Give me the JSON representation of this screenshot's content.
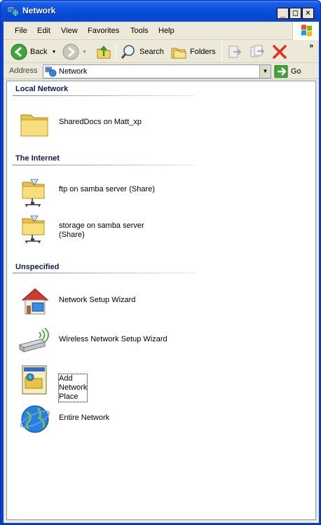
{
  "window": {
    "title": "Network",
    "controls": {
      "minimize": "_",
      "maximize": "□",
      "close": "×"
    }
  },
  "menu": [
    "File",
    "Edit",
    "View",
    "Favorites",
    "Tools",
    "Help"
  ],
  "toolbar": {
    "back_label": "Back",
    "search_label": "Search",
    "folders_label": "Folders",
    "more": "»"
  },
  "address": {
    "label": "Address",
    "value": "Network",
    "go_label": "Go"
  },
  "groups": {
    "local": {
      "title": "Local Network",
      "items": [
        {
          "label": "SharedDocs on Matt_xp",
          "icon": "folder-icon"
        }
      ]
    },
    "internet": {
      "title": "The Internet",
      "items": [
        {
          "label": "ftp on samba server (Share)",
          "icon": "network-share-icon"
        },
        {
          "label": "storage on samba server (Share)",
          "icon": "network-share-icon"
        }
      ]
    },
    "unspecified": {
      "title": "Unspecified",
      "items": [
        {
          "label": "Network Setup Wizard",
          "icon": "home-network-icon"
        },
        {
          "label": "Wireless Network Setup Wizard",
          "icon": "wireless-usb-icon"
        },
        {
          "label": "Add Network Place",
          "icon": "add-network-place-icon"
        },
        {
          "label": "Entire Network",
          "icon": "globe-icon"
        }
      ]
    }
  },
  "colors": {
    "titlebar": "#0a4fde",
    "chrome": "#ece9d8",
    "group_header": "#0e1a5c",
    "close_red": "#e0301e"
  }
}
